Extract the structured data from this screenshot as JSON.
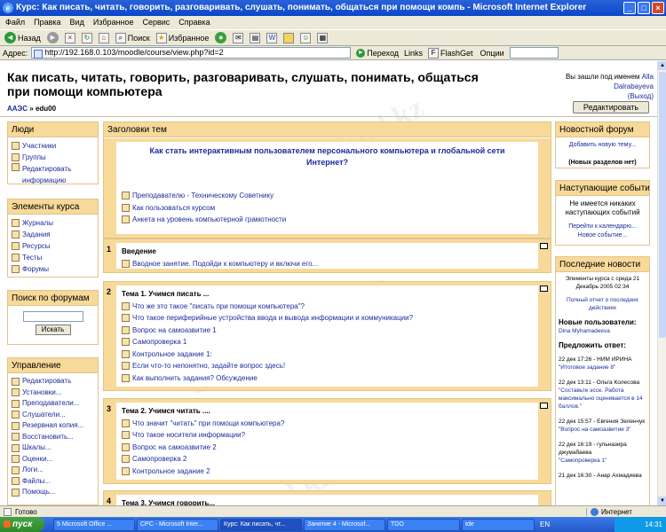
{
  "window": {
    "title": "Курс: Как писать, читать, говорить, разговаривать, слушать, понимать, общаться при помощи компь - Microsoft Internet Explorer"
  },
  "menu": [
    "Файл",
    "Правка",
    "Вид",
    "Избранное",
    "Сервис",
    "Справка"
  ],
  "toolbar": {
    "back": "Назад",
    "search": "Поиск",
    "favorites": "Избранное"
  },
  "address": {
    "label": "Адрес:",
    "url": "http://192.168.0.103/moodle/course/view.php?id=2",
    "go": "Переход",
    "links": "Links",
    "flashget": "FlashGet",
    "options": "Опции"
  },
  "course": {
    "title": "Как писать, читать, говорить, разговаривать, слушать, понимать, общаться при помощи компьютера",
    "logged_in_prefix": "Вы зашли под именем",
    "user_name": "Alla Dalrabayeva",
    "logout": "(Выход)",
    "breadcrumb_home": "AAЭС",
    "breadcrumb_sep": " » ",
    "breadcrumb_current": "edu00",
    "edit_button": "Редактировать"
  },
  "left": {
    "people": {
      "title": "Люди",
      "items": [
        "Участники",
        "Группы",
        "Редактировать информацию"
      ]
    },
    "activities": {
      "title": "Элементы курса",
      "items": [
        "Журналы",
        "Задания",
        "Ресурсы",
        "Тесты",
        "Форумы"
      ]
    },
    "forum_search": {
      "title": "Поиск по форумам",
      "button": "Искать"
    },
    "admin": {
      "title": "Управление",
      "items": [
        "Редактировать",
        "Установки...",
        "Преподаватели...",
        "Слушатели...",
        "Резервная копия...",
        "Восстановить...",
        "Шкалы...",
        "Оценки...",
        "Логи...",
        "Файлы...",
        "Помощь..."
      ]
    }
  },
  "main": {
    "header": "Заголовки тем",
    "intro_title": "Как стать интерактивным пользователем персонального компьютера и глобальной сети Интернет?",
    "intro_items": [
      "Преподавателю - Техническому Советнику",
      "Как пользоваться курсом",
      "Анкета на уровень компьютерной грамотности"
    ],
    "sections": [
      {
        "num": "1",
        "title": "Введение",
        "items": [
          "Вводное занятие. Подойди к компьютеру и включи его..."
        ]
      },
      {
        "num": "2",
        "title": "Тема 1. Учимся писать ...",
        "items": [
          "Что же это такое \"писать при помощи компьютера\"?",
          "Что такое периферийные устройства ввода и вывода информации и коммуникации?",
          "Вопрос на самоазвитие 1",
          "Самопроверка 1",
          "Контрольное задание 1:",
          "Если что-то непонятно, задайте вопрос здесь!",
          "Как выполнить задания? Обсуждение"
        ]
      },
      {
        "num": "3",
        "title": "Тема 2. Учимся читать ....",
        "items": [
          "Что значит \"читать\" при помощи компьютера?",
          "Что такое носители информации?",
          "Вопрос на самоазвитие 2",
          "Самопроверка 2",
          "Контрольное задание 2"
        ]
      },
      {
        "num": "4",
        "title": "Тема 3. Учимся говорить...",
        "items": []
      }
    ]
  },
  "right": {
    "news_forum": {
      "title": "Новостной форум",
      "add": "Добавить новую тему...",
      "none": "(Новых разделов нет)"
    },
    "events": {
      "title": "Наступающие события",
      "none": "Не имеется никаких наступающих событий",
      "calendar": "Перейти к календарю...",
      "new_event": "Новое событие..."
    },
    "recent": {
      "title": "Последние новости",
      "since": "Элементы курса с среда 21 Декабрь 2005 02:34",
      "full_report": "Полный отчет о последних действиях",
      "new_users_title": "Новые пользователи:",
      "new_user": "Dina Myhamadeeva",
      "posts_title": "Предложить ответ:",
      "posts": [
        {
          "meta": "22 дек 17:26 - НИМ ИРИНА",
          "text": "\"Итоговое задание 8\""
        },
        {
          "meta": "22 дек 13:11 - Ольга Колесова",
          "text": "\"Составьте эссе. Работа максимально оценивается в 14 баллов.\""
        },
        {
          "meta": "22 дек 15:57 - Евгения Зеленчук",
          "text": "\"Вопрос на самоазвитие 3\""
        },
        {
          "meta": "22 дек 16:19 - гульназира джумабаева",
          "text": "\"Самопроверка 1\""
        },
        {
          "meta": "21 дек 16:30 - Анар Ахмадиева",
          "text": ""
        }
      ]
    }
  },
  "status": {
    "ready": "Готово",
    "zone": "Интернет"
  },
  "taskbar": {
    "start": "пуск",
    "buttons": [
      "5 Microsoft Office ...",
      "CPC - Microsoft Inter...",
      "Курс: Как писать, чт...",
      "Занятие 4 - Microsof...",
      "TDO",
      "tde"
    ],
    "lang": "EN",
    "time": "14:31"
  },
  "watermark": "Stud.kz - Stud.kz"
}
